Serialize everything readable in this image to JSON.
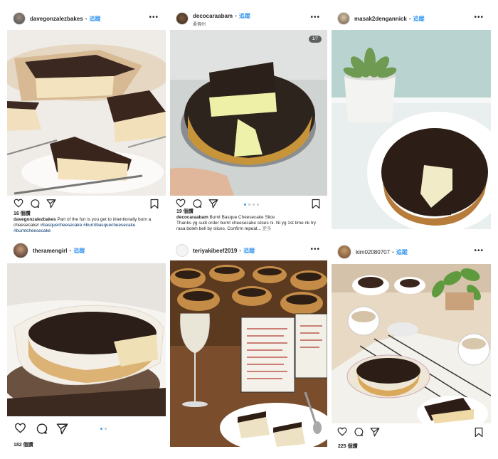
{
  "posts": [
    {
      "username": "davegonzalezbakes",
      "follow": "追蹤",
      "likes": "16 個讚",
      "caption_user": "davegonzalezbakes",
      "caption_text": "Part of the fun is you get to intentionally burn a cheesecake!",
      "hashtags": "#basquecheesecake #burntbasquecheesecake #burntcheesecake"
    },
    {
      "username": "decocaraabam",
      "follow": "追蹤",
      "location": "柔佛州",
      "counter": "1/7",
      "likes": "19 個讚",
      "caption_user": "decocaraabam",
      "caption_text": "Burnt Basque Cheesecake Slice",
      "caption_line2": "Thanks yg sudi order burnt cheesecake slices ni. Ni yg 1st time nk try rasa boleh beli by slices. Confirm repeat...",
      "more": "更多"
    },
    {
      "username": "masak2dengannick",
      "follow": "追蹤"
    },
    {
      "username": "theramengirl",
      "follow": "追蹤",
      "likes": "182 個讚"
    },
    {
      "username": "teriyakibeef2019",
      "follow": "追蹤"
    },
    {
      "username": "kim02080707",
      "follow": "追蹤",
      "likes": "225 個讚"
    }
  ]
}
